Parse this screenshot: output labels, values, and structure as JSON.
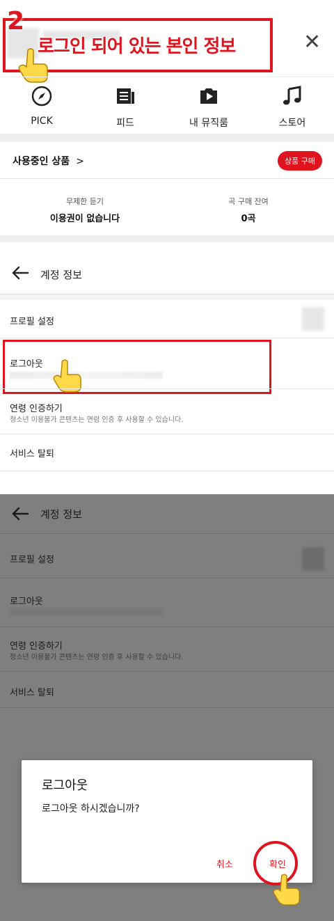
{
  "annotation": {
    "step_number": "2",
    "caption": "로그인 되어 있는 본인 정보"
  },
  "nav": {
    "items": [
      {
        "label": "PICK",
        "icon": "compass-icon"
      },
      {
        "label": "피드",
        "icon": "feed-icon"
      },
      {
        "label": "내 뮤직룸",
        "icon": "play-box-icon"
      },
      {
        "label": "스토어",
        "icon": "music-note-icon"
      }
    ]
  },
  "products": {
    "title": "사용중인 상품",
    "chevron": ">",
    "buy_label": "상품 구매",
    "unlimited_label": "무제한 듣기",
    "unlimited_value": "이용권이 없습니다",
    "remaining_label": "곡 구매 잔여",
    "remaining_value": "0곡"
  },
  "account": {
    "title": "계정 정보",
    "items": [
      {
        "label": "프로필 설정"
      },
      {
        "label": "로그아웃"
      },
      {
        "label": "연령 인증하기",
        "desc": "청소년 이용불가 콘텐츠는 연령 인증 후 사용할 수 있습니다."
      },
      {
        "label": "서비스 탈퇴"
      }
    ]
  },
  "dialog": {
    "title": "로그아웃",
    "message": "로그아웃 하시겠습니까?",
    "cancel": "취소",
    "confirm": "확인"
  },
  "colors": {
    "accent": "#e0141e",
    "dim_overlay": "#7f7f7f"
  }
}
